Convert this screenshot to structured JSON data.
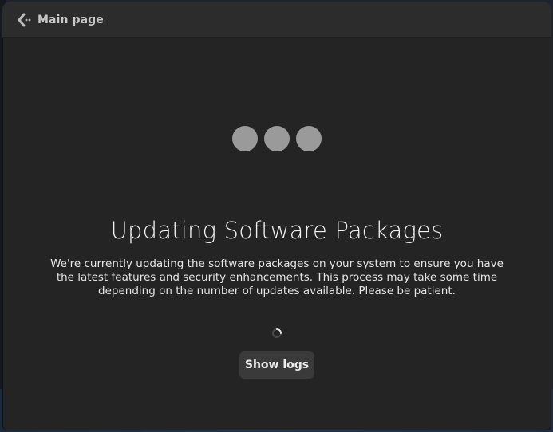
{
  "header": {
    "back_label": "Main page",
    "back_icon": "back-arrow-icon"
  },
  "main": {
    "loading_dots_count": 3,
    "title": "Updating Software Packages",
    "description": "We're currently updating the software packages on your system to ensure you have the latest features and security enhancements. This process may take some time depending on the number of updates available. Please be patient.",
    "spinner_icon": "spinner-icon",
    "show_logs_label": "Show logs"
  },
  "colors": {
    "window_bg": "#242424",
    "headerbar_bg": "#2c2c2c",
    "dot": "#9a9a9a",
    "button_bg": "#3a3a3a",
    "text": "#f2f2f2"
  }
}
